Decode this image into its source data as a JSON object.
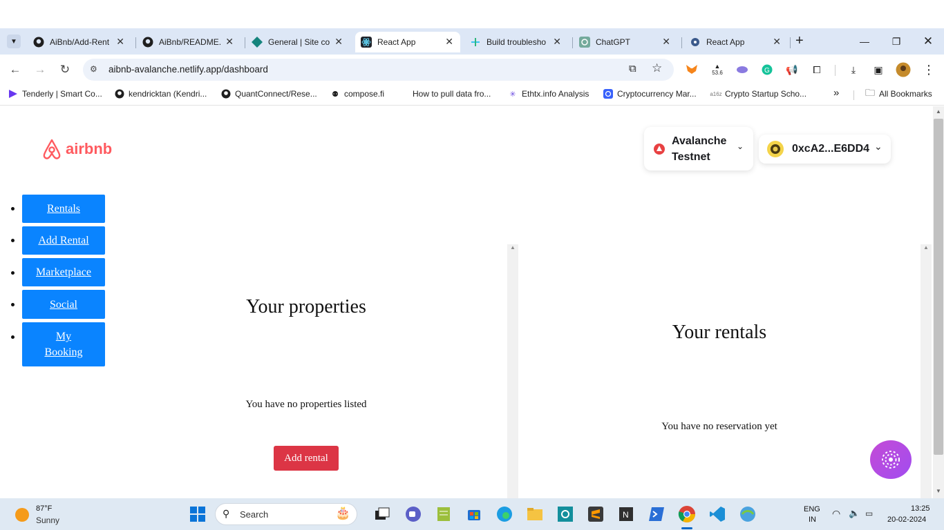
{
  "tabs": [
    {
      "title": "AiBnb/Add-Rent",
      "icon": "github-icon"
    },
    {
      "title": "AiBnb/README.",
      "icon": "github-icon"
    },
    {
      "title": "General | Site co",
      "icon": "netlify-icon"
    },
    {
      "title": "React App",
      "icon": "react-icon",
      "active": true
    },
    {
      "title": "Build troublesho",
      "icon": "slack-icon"
    },
    {
      "title": "ChatGPT",
      "icon": "chatgpt-icon"
    },
    {
      "title": "React App",
      "icon": "react-icon"
    }
  ],
  "new_tab_label": "+",
  "address": {
    "url": "aibnb-avalanche.netlify.app/dashboard"
  },
  "extensions": {
    "badge": "53.6"
  },
  "bookmarks": [
    {
      "label": "Tenderly | Smart Co...",
      "icon": "tenderly-icon"
    },
    {
      "label": "kendricktan (Kendri...",
      "icon": "github-icon"
    },
    {
      "label": "QuantConnect/Rese...",
      "icon": "github-icon"
    },
    {
      "label": "compose.fi",
      "icon": "compose-icon"
    },
    {
      "label": "How to pull data fro...",
      "icon": "blank-icon"
    },
    {
      "label": "Ethtx.info Analysis",
      "icon": "ethtx-icon"
    },
    {
      "label": "Cryptocurrency Mar...",
      "icon": "coinmarketcap-icon"
    },
    {
      "label": "Crypto Startup Scho...",
      "icon": "a16z-icon"
    }
  ],
  "bookmarks_more": "»",
  "all_bookmarks": "All Bookmarks",
  "app": {
    "logo_text": "airbnb",
    "network": {
      "line1": "Avalanche",
      "line2": "Testnet"
    },
    "account": "0xcA2...E6DD4",
    "nav": [
      {
        "label": "Rentals"
      },
      {
        "label": "Add Rental"
      },
      {
        "label": "Marketplace"
      },
      {
        "label": "Social"
      },
      {
        "label_line1": "My",
        "label_line2": "Booking"
      }
    ],
    "properties": {
      "title": "Your properties",
      "empty": "You have no properties listed",
      "add_button": "Add rental"
    },
    "rentals": {
      "title": "Your rentals",
      "empty": "You have no reservation yet"
    }
  },
  "taskbar": {
    "weather_temp": "87°F",
    "weather_desc": "Sunny",
    "search_placeholder": "Search",
    "lang_line1": "ENG",
    "lang_line2": "IN",
    "time": "13:25",
    "date": "20-02-2024"
  },
  "colors": {
    "brand": "#ff5a5f",
    "nav_button": "#0a84ff",
    "add_button": "#dc3545",
    "tab_strip": "#dde7f6"
  }
}
